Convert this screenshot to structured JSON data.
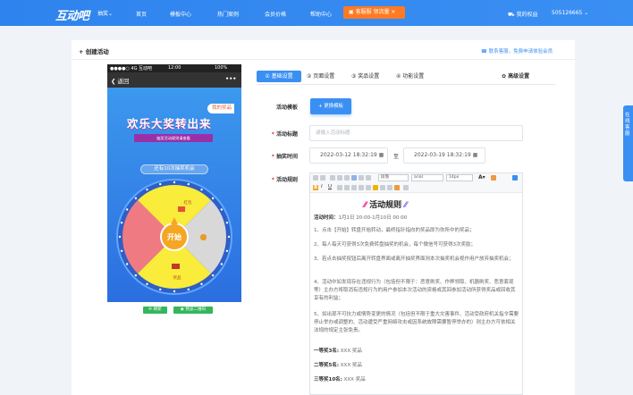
{
  "nav": {
    "logo": "互动吧",
    "city": "抽奖",
    "items": [
      "首页",
      "模板中心",
      "热门案例",
      "会员价格",
      "帮助中心"
    ],
    "promo": "客服服 领流量",
    "my_rights": "我的权益",
    "user": "505126665"
  },
  "page": {
    "breadcrumb": "+ 创建活动",
    "help": "联系客服，免费申请体验会员"
  },
  "phone": {
    "carrier": "●●●●○ 4G 互动吧",
    "time": "12:00",
    "battery": "100%",
    "back": "返回",
    "more": "•••",
    "my_prize": "我的奖品",
    "title": "欢乐大奖转出来",
    "subtitle": "抽奖活动规则请查看",
    "remain": "还有10次抽奖机会",
    "start": "开始",
    "wheel_labels": [
      "红包",
      "奖品",
      "谢谢",
      "奖品",
      "谢谢",
      "奖品"
    ]
  },
  "preview": {
    "refresh": "刷新",
    "qr": "预览二维码"
  },
  "tabs": [
    "① 基础设置",
    "② 页面设置",
    "③ 奖品设置",
    "④ 功能设置"
  ],
  "advanced": "高级设置",
  "form": {
    "template_label": "活动模板",
    "template_button": "更换模板",
    "title_label": "活动标题",
    "title_placeholder": "请输入活动标题",
    "time_label": "抽奖时间",
    "start_time": "2022-03-12 18:32:19",
    "to": "至",
    "end_time": "2022-03-19 18:32:19",
    "rules_label": "活动规则"
  },
  "editor": {
    "style_select": "段落",
    "font_select": "arial",
    "size_select": "14px",
    "rules_title": "活动规则",
    "time_bold": "活动时间：",
    "time_value": "1月1日 20:00-1月10日 00:00",
    "p1": "1、点击【开始】转盘开始转动，最终指针指向的奖品即为你所中的奖品；",
    "p2": "2、每人每天可获得3次免费转盘抽奖的机会，每个微信号可获得3次奖励；",
    "p3": "3、若点击抽奖按钮后离开转盘界面或离开抽奖界面则本次抽奖机会视作用户放弃抽奖机会；",
    "p4": "4、活动中如发现存在违规行为（包括但不限于：恶意刷奖、作弊领取、机器刷奖、恶意套现等）主办方将取消有违规行为的用户参加本次活动的资格或其回参加活动所获得奖品或回收其享有的利益；",
    "p5": "5、如出现不可抗力或情势变更的情况（包括但不限于重大灾害事件、活动受政府机关指令需要停止举办或调整的、活动遭受严重网络攻击或因系统故障需要暂停举办的）则主办方可依相关法规的规定主张免责。",
    "prize1_b": "一等奖3名:",
    "prize1_v": " XXX 奖品",
    "prize2_b": "二等奖5名:",
    "prize2_v": " XXX 奖品",
    "prize3_b": "三等奖10名:",
    "prize3_v": " XXX 奖品"
  },
  "side_tab": "在线客服",
  "colors": {
    "accent": "#3a8ff3",
    "wheel_red": "#f07a82",
    "wheel_yellow": "#f9ec3a",
    "wheel_gray": "#d8d8d8",
    "promo": "#ff7a22"
  }
}
